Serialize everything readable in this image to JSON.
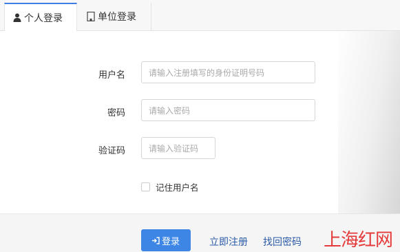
{
  "tabs": [
    {
      "label": "个人登录",
      "icon": "user-icon",
      "active": true
    },
    {
      "label": "单位登录",
      "icon": "building-icon",
      "active": false
    }
  ],
  "form": {
    "username": {
      "label": "用户名",
      "placeholder": "请输入注册填写的身份证明号码"
    },
    "password": {
      "label": "密码",
      "placeholder": "请输入密码"
    },
    "captcha": {
      "label": "验证码",
      "placeholder": "请输入验证码"
    },
    "remember": {
      "label": "记住用户名",
      "checked": false
    }
  },
  "actions": {
    "login": {
      "label": "登录",
      "icon": "sign-in-icon"
    },
    "register": "立即注册",
    "forgot": "找回密码"
  },
  "watermark": "上海红网",
  "colors": {
    "primary": "#3d86e6",
    "link": "#2a5aa8",
    "watermark": "#e43a3a"
  }
}
